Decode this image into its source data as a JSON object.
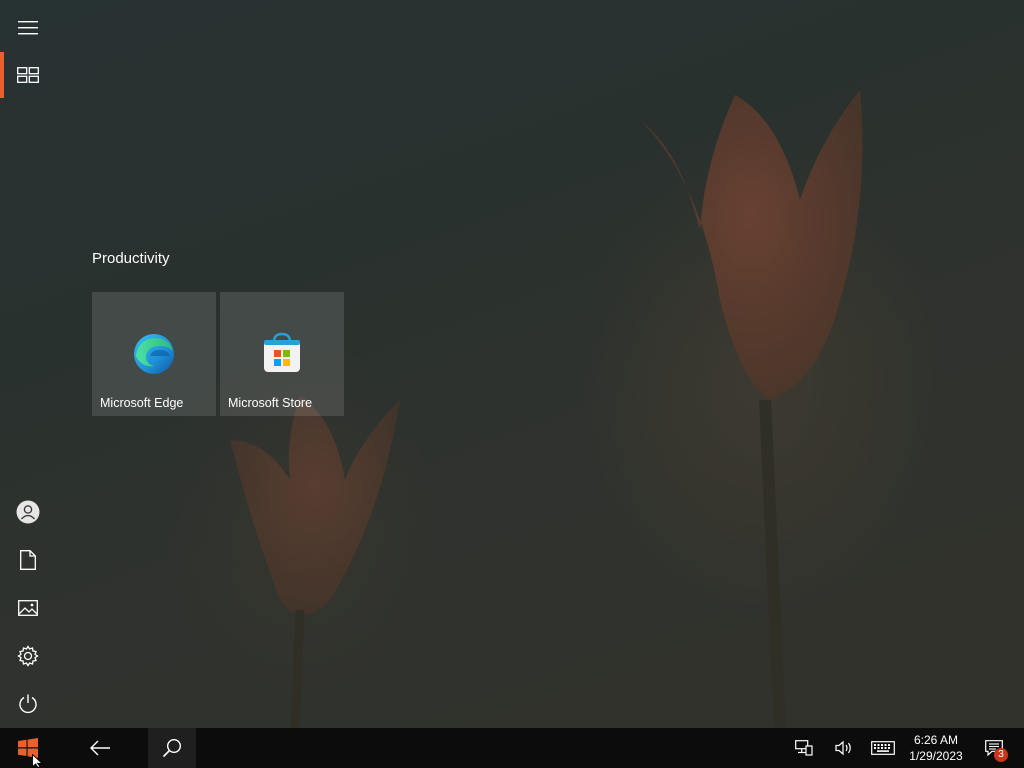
{
  "start_menu": {
    "group_title": "Productivity",
    "tiles": [
      {
        "label": "Microsoft Edge",
        "icon": "microsoft-edge-icon"
      },
      {
        "label": "Microsoft Store",
        "icon": "microsoft-store-icon"
      }
    ],
    "left_rail": {
      "items": [
        {
          "icon": "hamburger-menu-icon"
        },
        {
          "icon": "all-tiles-icon",
          "selected": true
        },
        {
          "icon": "user-account-icon"
        },
        {
          "icon": "documents-icon"
        },
        {
          "icon": "pictures-icon"
        },
        {
          "icon": "settings-gear-icon"
        },
        {
          "icon": "power-icon"
        }
      ]
    }
  },
  "taskbar": {
    "time": "6:26 AM",
    "date": "1/29/2023",
    "notification_count": "3",
    "tray_icons": [
      "network-icon",
      "volume-icon",
      "touch-keyboard-icon",
      "action-center-icon"
    ]
  },
  "colors": {
    "accent": "#e8612c",
    "taskbar_bg": "#0c0c0c",
    "badge": "#c8351a"
  }
}
